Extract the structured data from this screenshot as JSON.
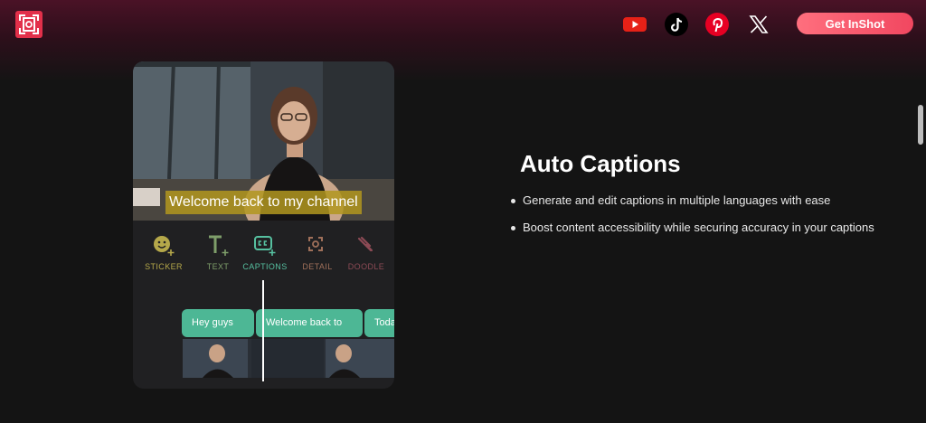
{
  "header": {
    "logo_icon": "inshot-logo-icon",
    "social": [
      "youtube-icon",
      "tiktok-icon",
      "pinterest-icon",
      "x-icon"
    ],
    "cta_label": "Get InShot"
  },
  "phone": {
    "caption": "Welcome back to my channel",
    "tools": [
      {
        "label": "STICKER",
        "icon": "sticker-icon",
        "color": "#b5a84a"
      },
      {
        "label": "TEXT",
        "icon": "text-icon",
        "color": "#7e9e6a"
      },
      {
        "label": "CAPTIONS",
        "icon": "captions-icon",
        "color": "#56c0a0"
      },
      {
        "label": "DETAIL",
        "icon": "detail-icon",
        "color": "#a0705a"
      },
      {
        "label": "DOODLE",
        "icon": "doodle-icon",
        "color": "#8c4a55"
      }
    ],
    "clips": [
      "Hey guys",
      "Welcome back to",
      "Toda"
    ]
  },
  "feature": {
    "title": "Auto Captions",
    "bullets": [
      "Generate and edit captions in multiple languages with ease",
      "Boost content accessibility while securing accuracy in your captions"
    ]
  },
  "colors": {
    "accent": "#f14760",
    "caption_clip": "#4db795",
    "background": "#141414"
  }
}
